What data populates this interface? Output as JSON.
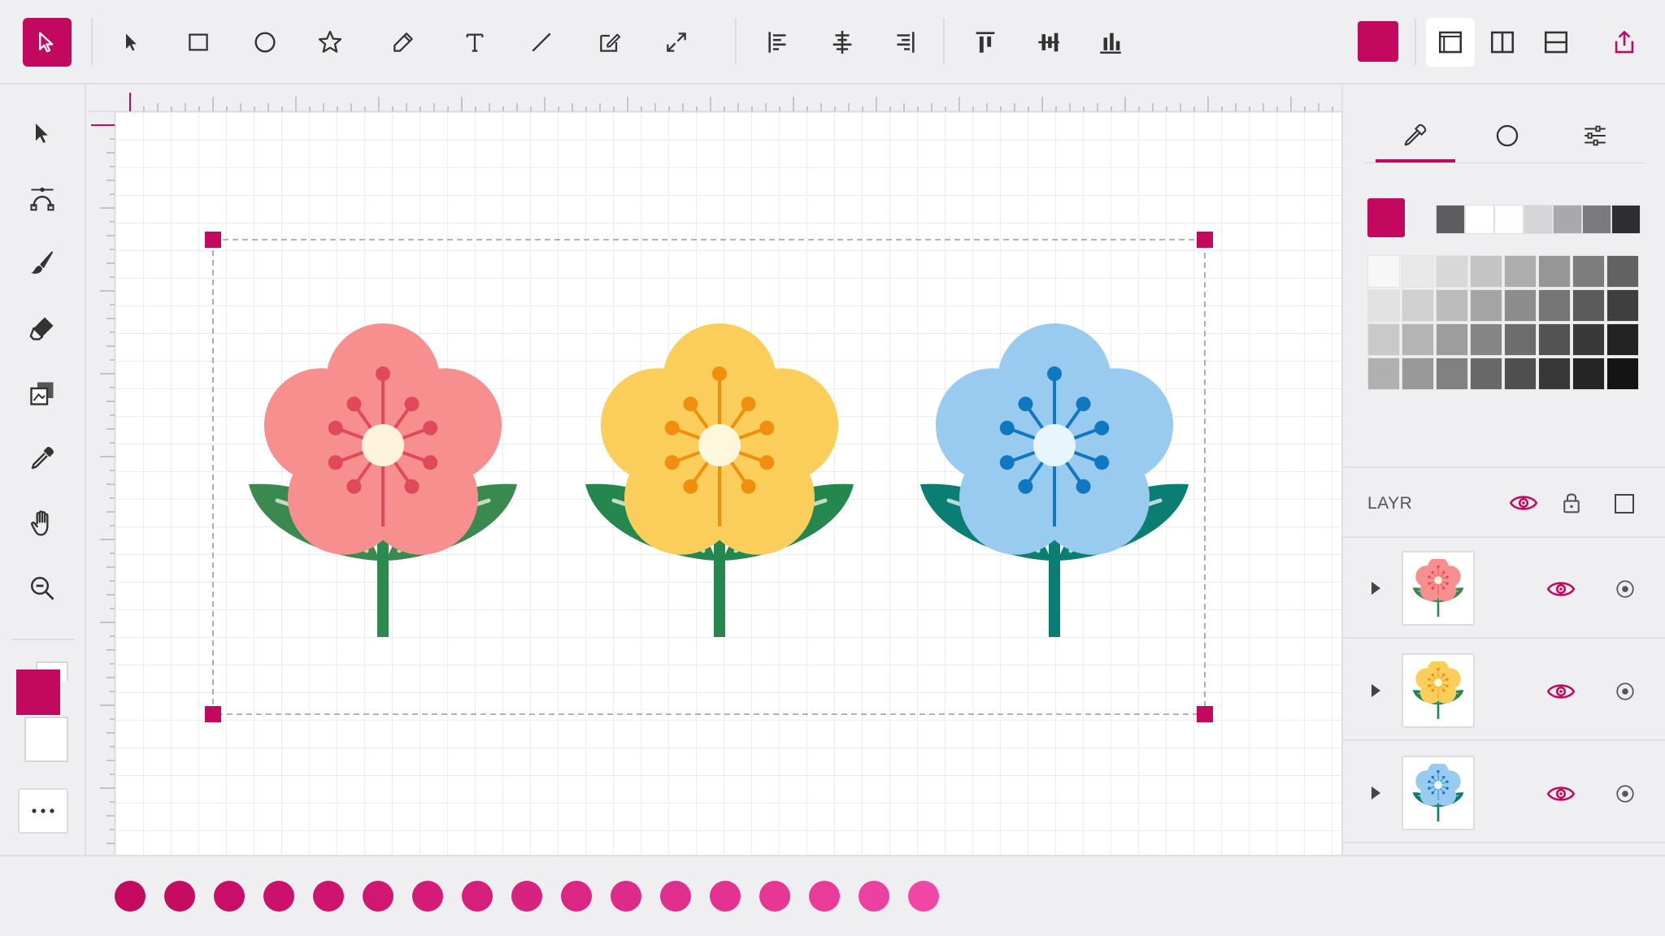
{
  "toolbar": {
    "active_tool": "select-tool",
    "tools": [
      "select",
      "rectangle",
      "ellipse",
      "star",
      "pen",
      "text",
      "line",
      "edit-shape",
      "resize"
    ],
    "align": [
      "align-left",
      "align-center",
      "align-right",
      "align-top",
      "align-middle",
      "align-bottom"
    ],
    "fill_color": "#c2095f",
    "layouts": [
      "single-panel",
      "split-vertical",
      "split-horizontal"
    ]
  },
  "left_tools": [
    "select",
    "node-edit",
    "brush",
    "eraser",
    "layers-stack",
    "eyedropper",
    "hand",
    "zoom"
  ],
  "colors": {
    "accent": "#c2095f",
    "foreground": "#c2095f",
    "background": "#ffffff"
  },
  "right_panel": {
    "tabs": [
      "eyedropper",
      "circle",
      "sliders"
    ],
    "active_tab": 0,
    "current_color": "#c2095f",
    "quick_swatches": [
      "#5d5d5f",
      "#ffffff",
      "#fdfdfd",
      "#d6d6d8",
      "#a9a9ab",
      "#7b7b7d",
      "#2e2e30"
    ],
    "grid_swatches": [
      [
        "#f7f7f7",
        "#e9e9ea",
        "#d8d8d9",
        "#c4c4c5",
        "#adadae",
        "#969697",
        "#7d7d7e",
        "#636364"
      ],
      [
        "#e2e2e3",
        "#d0d0d1",
        "#bbbbbc",
        "#a5a5a6",
        "#8d8d8e",
        "#757576",
        "#5b5b5c",
        "#3f3f40"
      ],
      [
        "#c9c9ca",
        "#b4b4b5",
        "#9d9d9e",
        "#858586",
        "#6c6c6d",
        "#535354",
        "#39393a",
        "#232324"
      ],
      [
        "#b0b0b1",
        "#999999",
        "#818182",
        "#686869",
        "#4f4f50",
        "#383839",
        "#252526",
        "#141415"
      ]
    ]
  },
  "layers": {
    "title": "LAYR",
    "items": [
      {
        "name": "pink-flower-layer",
        "color": "#f78f8f"
      },
      {
        "name": "yellow-flower-layer",
        "color": "#fbcd5b"
      },
      {
        "name": "blue-flower-layer",
        "color": "#98cbef"
      }
    ]
  },
  "canvas": {
    "flowers": [
      {
        "petal": "#f78f8f",
        "stamen": "#e04959",
        "center": "#fdf3dd",
        "leaf": "#3a8a4f",
        "stem": "#2c8a4e",
        "vein": "#bfdcc0"
      },
      {
        "petal": "#fbcd5b",
        "stamen": "#f08e0d",
        "center": "#fdf7dc",
        "leaf": "#23874e",
        "stem": "#23874e",
        "vein": "#bfe0c0"
      },
      {
        "petal": "#98cbef",
        "stamen": "#0f78c0",
        "center": "#e6f6fc",
        "leaf": "#0b7e73",
        "stem": "#0b7e73",
        "vein": "#b6dcd6"
      }
    ]
  },
  "palette_strip": [
    "#c20a5f",
    "#c50c63",
    "#c80f67",
    "#ca126b",
    "#cd156f",
    "#d01873",
    "#d31b77",
    "#d51f7b",
    "#d8227f",
    "#db2683",
    "#de2a88",
    "#e02e8c",
    "#e33290",
    "#e63795",
    "#e93c9a",
    "#ec41a0",
    "#f046a6"
  ]
}
